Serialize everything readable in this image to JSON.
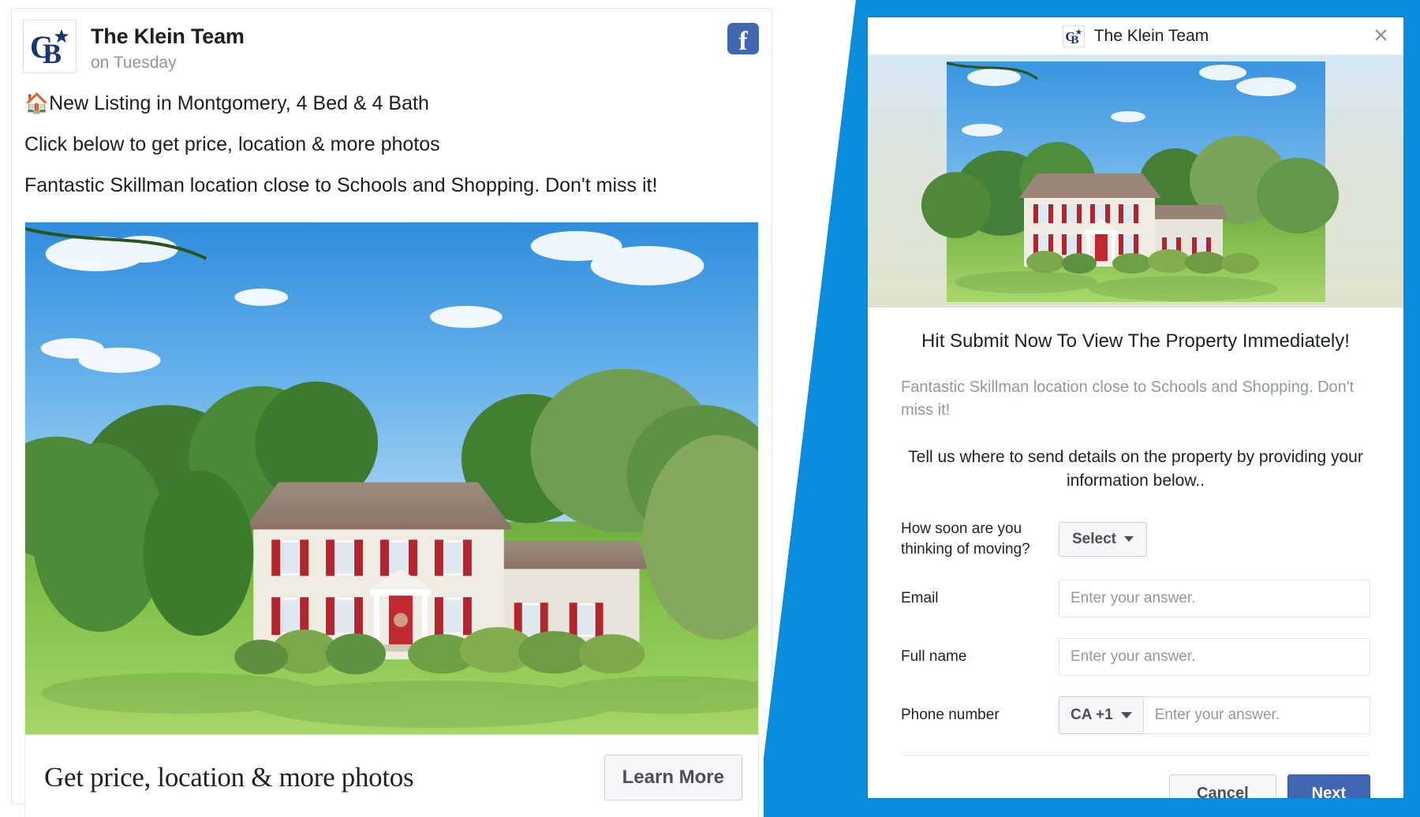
{
  "ad": {
    "page_name": "The Klein Team",
    "timestamp": "on Tuesday",
    "platform_icon": "facebook-icon",
    "platform_glyph": "f",
    "logo_icon": "coldwell-banker-logo",
    "lines": [
      "🏠New Listing in Montgomery, 4 Bed & 4 Bath",
      "Click below to get price, location & more photos",
      "Fantastic Skillman location close to Schools and Shopping. Don't miss it!"
    ],
    "photo_alt": "two-story colonial house with red shutters and green lawn",
    "cta": {
      "headline": "Get price, location & more photos",
      "button_label": "Learn More"
    }
  },
  "modal": {
    "title": "The Klein Team",
    "logo_icon": "coldwell-banker-logo",
    "close_icon": "close-icon",
    "close_glyph": "✕",
    "hero_alt": "two-story colonial house with red shutters and green lawn",
    "heading": "Hit Submit Now To View The Property Immediately!",
    "description": "Fantastic Skillman location close to Schools and Shopping. Don't miss it!",
    "subheading": "Tell us where to send details on the property by providing your information below..",
    "fields": [
      {
        "label": "How soon are you thinking of moving?",
        "type": "select",
        "value": "Select",
        "placeholder": ""
      },
      {
        "label": "Email",
        "type": "text",
        "value": "",
        "placeholder": "Enter your answer."
      },
      {
        "label": "Full name",
        "type": "text",
        "value": "",
        "placeholder": "Enter your answer."
      },
      {
        "label": "Phone number",
        "type": "phone",
        "country_code": "CA +1",
        "value": "",
        "placeholder": "Enter your answer."
      }
    ],
    "actions": {
      "cancel_label": "Cancel",
      "next_label": "Next"
    }
  },
  "colors": {
    "callout_blue": "#0a8ddc",
    "facebook_blue": "#4267b2",
    "logo_navy": "#16357a",
    "muted_text": "#90949c"
  }
}
